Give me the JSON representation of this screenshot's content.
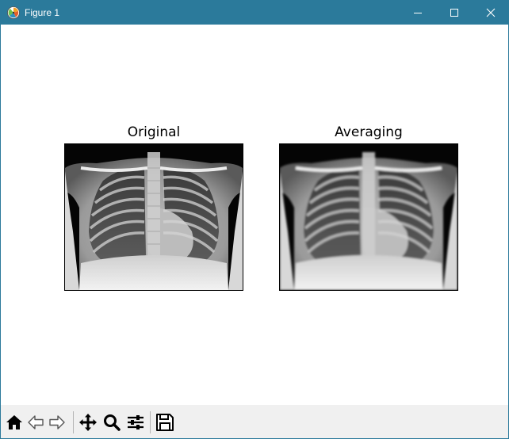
{
  "window": {
    "title": "Figure 1",
    "controls": [
      "minimize",
      "maximize",
      "close"
    ]
  },
  "subplots": [
    {
      "title": "Original",
      "image": "chest-xray",
      "blur": false
    },
    {
      "title": "Averaging",
      "image": "chest-xray",
      "blur": true
    }
  ],
  "toolbar": {
    "buttons": [
      {
        "icon": "home-icon",
        "tooltip": "Reset original view"
      },
      {
        "icon": "back-arrow-icon",
        "tooltip": "Back to previous view"
      },
      {
        "icon": "forward-arrow-icon",
        "tooltip": "Forward to next view"
      },
      {
        "icon": "pan-icon",
        "tooltip": "Pan axes"
      },
      {
        "icon": "zoom-icon",
        "tooltip": "Zoom to rectangle"
      },
      {
        "icon": "configure-subplots-icon",
        "tooltip": "Configure subplots"
      },
      {
        "icon": "save-icon",
        "tooltip": "Save the figure"
      }
    ]
  },
  "colors": {
    "titlebar": "#2b7a9b",
    "toolbar_bg": "#f0f0f0",
    "canvas_bg": "#ffffff"
  }
}
